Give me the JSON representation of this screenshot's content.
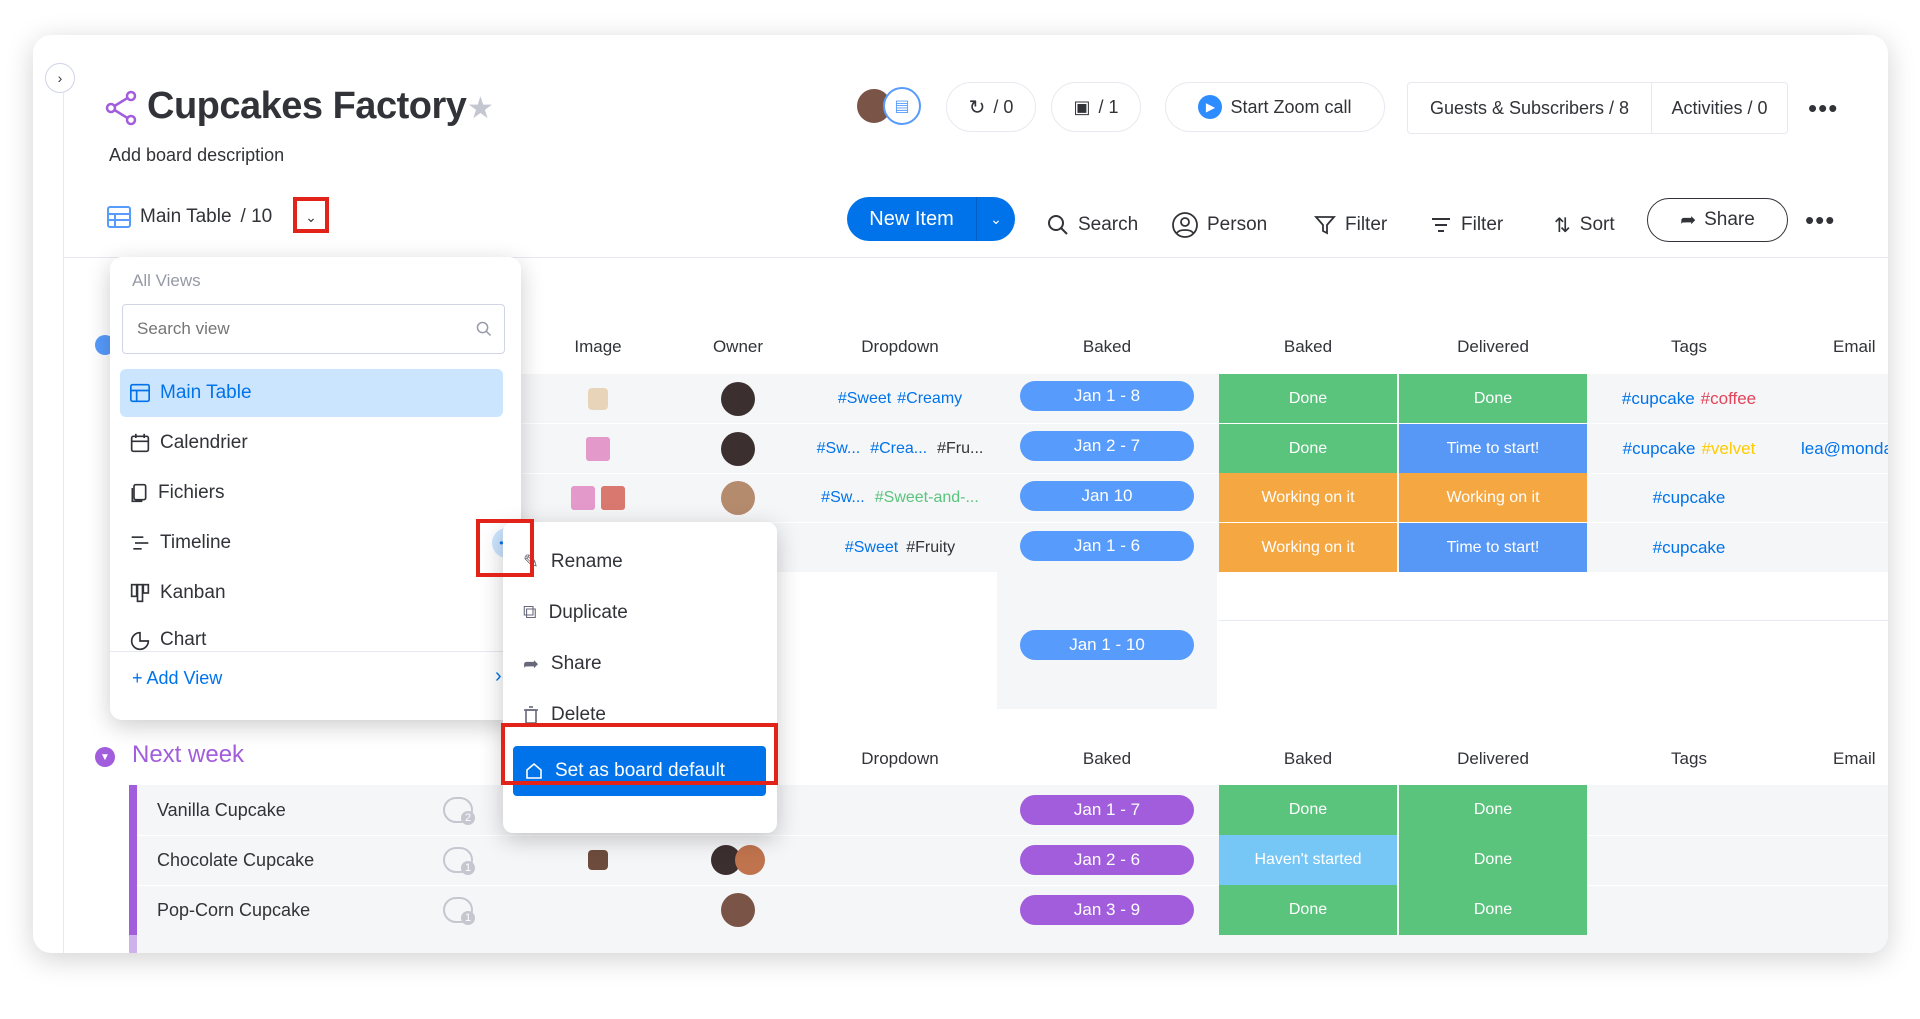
{
  "board": {
    "title": "Cupcakes Factory",
    "description": "Add board description"
  },
  "header": {
    "automations_count": "/ 0",
    "integrations_count": "/ 1",
    "zoom_label": "Start Zoom call",
    "guests_label": "Guests & Subscribers / 8",
    "activities_label": "Activities / 0"
  },
  "toolbar": {
    "view_name": "Main Table",
    "view_count": "/ 10",
    "new_item_label": "New Item",
    "search_label": "Search",
    "person_label": "Person",
    "filter_label": "Filter",
    "filter2_label": "Filter",
    "sort_label": "Sort",
    "share_label": "Share"
  },
  "views_panel": {
    "header": "All Views",
    "search_placeholder": "Search view",
    "items": [
      {
        "label": "Main Table",
        "icon": "table-icon",
        "active": true
      },
      {
        "label": "Calendrier",
        "icon": "calendar-icon"
      },
      {
        "label": "Fichiers",
        "icon": "files-icon"
      },
      {
        "label": "Timeline",
        "icon": "timeline-icon"
      },
      {
        "label": "Kanban",
        "icon": "kanban-icon"
      },
      {
        "label": "Chart",
        "icon": "chart-icon"
      }
    ],
    "add_view_label": "+ Add View"
  },
  "context_menu": {
    "items": [
      {
        "label": "Rename",
        "icon": "pencil-icon"
      },
      {
        "label": "Duplicate",
        "icon": "duplicate-icon"
      },
      {
        "label": "Share",
        "icon": "share-icon"
      },
      {
        "label": "Delete",
        "icon": "trash-icon"
      },
      {
        "label": "Set as board default",
        "icon": "home-icon",
        "highlighted": true
      }
    ]
  },
  "columns": [
    "Image",
    "Owner",
    "Dropdown",
    "Baked",
    "Baked",
    "Delivered",
    "Tags",
    "Email"
  ],
  "group1": {
    "rows": [
      {
        "dropdown": [
          "#Sweet",
          "#Creamy"
        ],
        "timeline": "Jan 1 - 8",
        "baked": "Done",
        "delivered": "Done",
        "tags": [
          "#cupcake",
          "#coffee"
        ],
        "email": ""
      },
      {
        "dropdown": [
          "#Sw...",
          "#Crea...",
          "#Fru..."
        ],
        "timeline": "Jan 2 - 7",
        "baked": "Done",
        "delivered": "Time to start!",
        "tags": [
          "#cupcake",
          "#velvet"
        ],
        "email": "lea@monda"
      },
      {
        "dropdown": [
          "#Sw...",
          "#Sweet-and-..."
        ],
        "timeline": "Jan 10",
        "baked": "Working on it",
        "delivered": "Working on it",
        "tags": [
          "#cupcake"
        ],
        "email": ""
      },
      {
        "dropdown": [
          "#Sweet",
          "#Fruity"
        ],
        "timeline": "Jan 1 - 6",
        "baked": "Working on it",
        "delivered": "Time to start!",
        "tags": [
          "#cupcake"
        ],
        "email": ""
      }
    ],
    "summary_timeline": "Jan 1 - 10"
  },
  "group2": {
    "title": "Next week",
    "rows": [
      {
        "name": "Vanilla Cupcake",
        "updates": "2",
        "timeline": "Jan 1 - 7",
        "baked": "Done",
        "delivered": "Done"
      },
      {
        "name": "Chocolate Cupcake",
        "updates": "1",
        "timeline": "Jan 2 - 6",
        "baked": "Haven't started",
        "delivered": "Done"
      },
      {
        "name": "Pop-Corn Cupcake",
        "updates": "1",
        "timeline": "Jan 3 - 9",
        "baked": "Done",
        "delivered": "Done"
      }
    ]
  },
  "colors": {
    "primary": "#0073ea",
    "done": "#5ac47d",
    "working": "#f5a742",
    "time_to_start": "#5797f5",
    "havent_started": "#77c7f6",
    "group_purple": "#a25ddc",
    "timeline_blue": "#579bfc",
    "highlight_red": "#e2231a"
  }
}
